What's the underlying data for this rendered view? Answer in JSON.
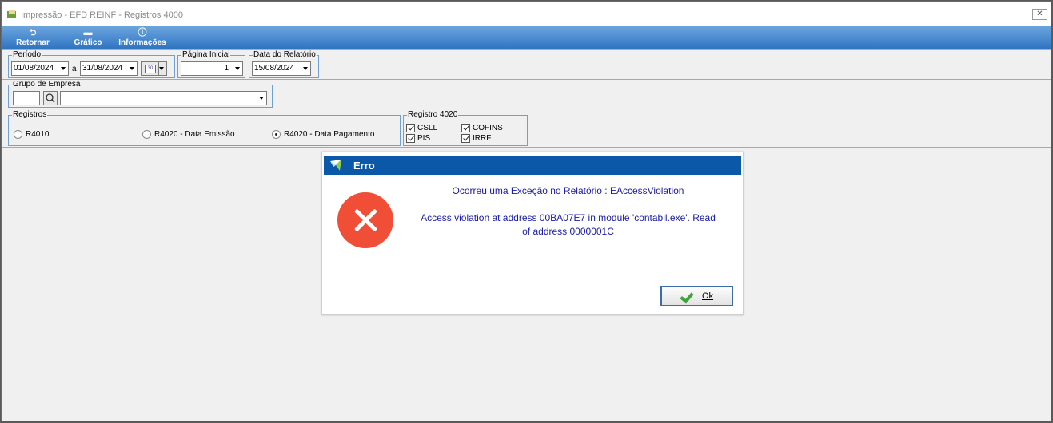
{
  "window": {
    "title": "Impressão - EFD REINF - Registros 4000",
    "close_icon": "close-icon"
  },
  "toolbar": {
    "retornar": "Retornar",
    "grafico": "Gráfico",
    "informacoes": "Informações"
  },
  "periodo": {
    "legend": "Período",
    "start": "01/08/2024",
    "separator": "a",
    "end": "31/08/2024"
  },
  "pagina_inicial": {
    "legend": "Página Inicial",
    "value": "1"
  },
  "data_relatorio": {
    "legend": "Data do Relatório",
    "value": "15/08/2024"
  },
  "grupo_empresa": {
    "legend": "Grupo de Empresa",
    "code": "",
    "name": ""
  },
  "registros": {
    "legend": "Registros",
    "options": [
      {
        "label": "R4010",
        "selected": false
      },
      {
        "label": "R4020 - Data Emissão",
        "selected": false
      },
      {
        "label": "R4020 - Data Pagamento",
        "selected": true
      }
    ]
  },
  "registro_4020": {
    "legend": "Registro 4020",
    "checks": [
      {
        "label": "CSLL",
        "checked": true
      },
      {
        "label": "COFINS",
        "checked": true
      },
      {
        "label": "PIS",
        "checked": true
      },
      {
        "label": "IRRF",
        "checked": true
      }
    ]
  },
  "calendar_icon_text": "30",
  "dialog": {
    "title": "Erro",
    "message_1": "Ocorreu uma Exceção no Relatório : EAccessViolation",
    "message_2_line1": "Access violation at address 00BA07E7 in module 'contabil.exe'. Read",
    "message_2_line2": "of address 0000001C",
    "ok_label": "Ok",
    "error_color": "#f04e37",
    "title_color": "#0b57a8"
  }
}
